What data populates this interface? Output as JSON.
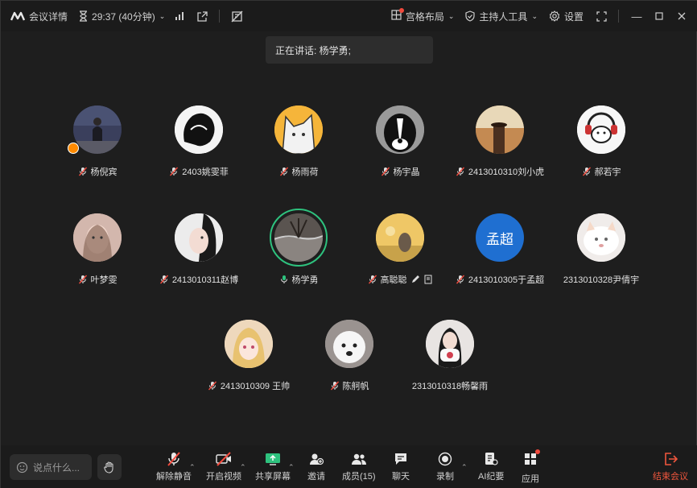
{
  "topbar": {
    "meeting_info": "会议详情",
    "timer": "29:37 (40分钟)",
    "layout": "宫格布局",
    "host_tools": "主持人工具",
    "settings": "设置"
  },
  "speaking": {
    "text": "正在讲话: 杨学勇;"
  },
  "participants": [
    {
      "name": "杨倪宾"
    },
    {
      "name": "2403姚雯菲"
    },
    {
      "name": "杨雨荷"
    },
    {
      "name": "杨宇晶"
    },
    {
      "name": "2413010310刘小虎"
    },
    {
      "name": "郝若宇"
    },
    {
      "name": "叶梦雯"
    },
    {
      "name": "2413010311赵博"
    },
    {
      "name": "杨学勇"
    },
    {
      "name": "高聪聪"
    },
    {
      "name": "2413010305于孟超",
      "avatar_text": "孟超"
    },
    {
      "name": "2313010328尹倩宇"
    },
    {
      "name": "2413010309 王帅"
    },
    {
      "name": "陈舸帆"
    },
    {
      "name": "2313010318畅馨雨"
    }
  ],
  "bottombar": {
    "chat_placeholder": "说点什么...",
    "unmute": "解除静音",
    "start_video": "开启视频",
    "share_screen": "共享屏幕",
    "invite": "邀请",
    "members": "成员(15)",
    "chat": "聊天",
    "record": "录制",
    "ai_minutes": "AI纪要",
    "apps": "应用",
    "end_meeting": "结束会议"
  },
  "colors": {
    "accent_green": "#2ec27e",
    "end_red": "#f0563d",
    "host_orange": "#ff8a00",
    "avatar_blue": "#1f6fd1"
  }
}
